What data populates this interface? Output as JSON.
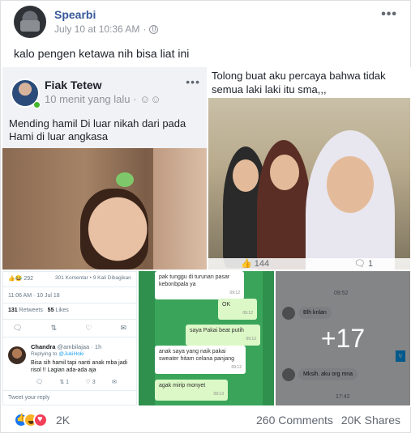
{
  "post": {
    "author": "Spearbi",
    "timestamp": "July 10 at 10:36 AM",
    "separator": "·",
    "caption": "kalo pengen ketawa nih bisa liat ini",
    "more_icon": "more-horizontal-icon",
    "privacy_icon": "globe-icon"
  },
  "tile1": {
    "name": "Fiak Tetew",
    "time": "10 menit yang lalu",
    "dots": "•••",
    "text": "Mending hamil Di luar nikah dari pada Hami di luar angkasa"
  },
  "tile2": {
    "text": "Tolong buat aku percaya bahwa tidak semua laki laki itu sma,,,",
    "likes": "144",
    "comments": "1"
  },
  "tile3": {
    "top_left": "292",
    "top_right": "301 Komentar • 9 Kali Dibagikan",
    "time": "11:06 AM · 10 Jul 18",
    "retweets_count": "131",
    "retweets_label": "Retweets",
    "likes_count": "55",
    "likes_label": "Likes",
    "reply_name": "Chandra",
    "reply_handle": "@ambilajaa · 1h",
    "replying_prefix": "Replying to",
    "replying_to": "@JukiHoki",
    "reply_text": "Bisa sih hamil tapi nanti anak mba jadi risol !! Lagian ada-ada aja",
    "reply_rt": "1",
    "reply_like": "3",
    "tweet_reply": "Tweet your reply"
  },
  "tile4": {
    "messages": [
      {
        "text": "pak tunggu di turunan pasar kebonbpala ya",
        "time": "09:12"
      },
      {
        "text": "OK",
        "time": "09:12"
      },
      {
        "text": "saya Pakai beat putih",
        "time": "09:12"
      },
      {
        "text": "anak saya yang naik pakai sweater hitam celana panjang",
        "time": "09:12"
      },
      {
        "text": "agak mirip monyet",
        "time": "09:13"
      }
    ]
  },
  "tile5": {
    "time_top": "09:52",
    "msg1": "Blh knlan",
    "badge": "iy",
    "msg2": "Mksih. aku org mna",
    "time_bottom": "17:42",
    "more_count": "+17"
  },
  "footer": {
    "reaction_count": "2K",
    "comments": "260 Comments",
    "shares": "20K Shares"
  }
}
